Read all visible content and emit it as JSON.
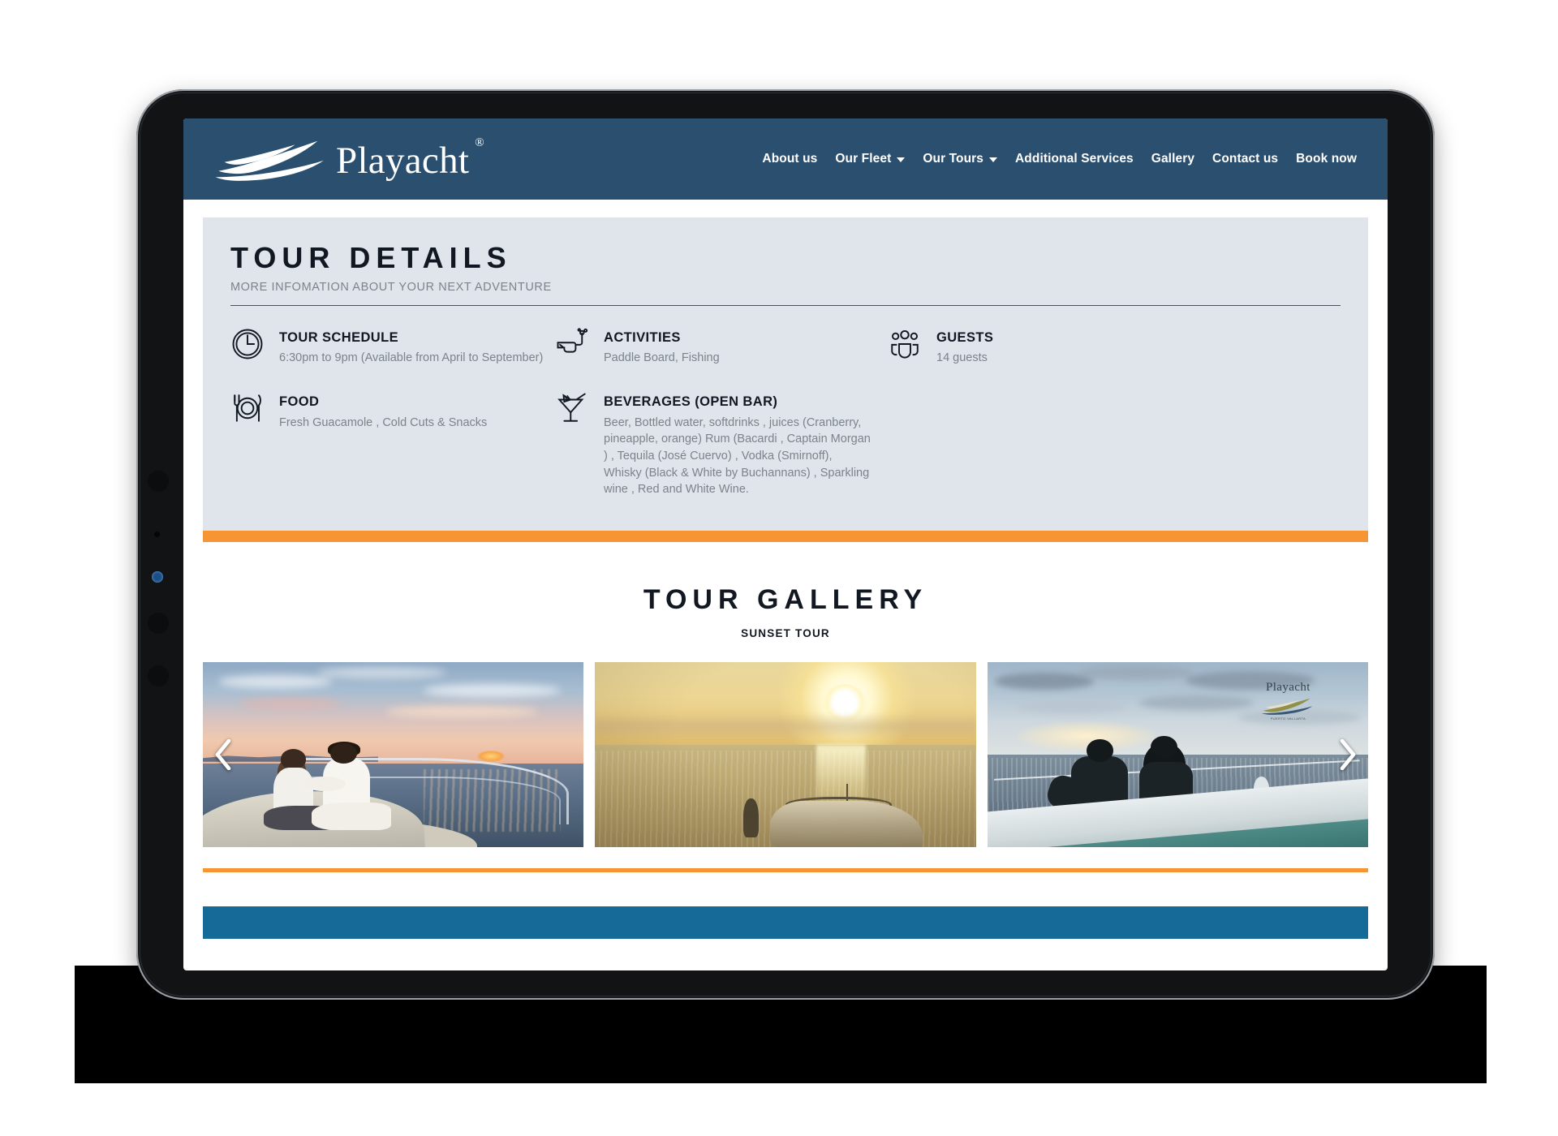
{
  "site": {
    "brand_name": "Playacht",
    "brand_trademark": "®"
  },
  "nav": {
    "items": [
      {
        "label": "About us",
        "has_caret": false
      },
      {
        "label": "Our Fleet",
        "has_caret": true
      },
      {
        "label": "Our Tours",
        "has_caret": true
      },
      {
        "label": "Additional Services",
        "has_caret": false
      },
      {
        "label": "Gallery",
        "has_caret": false
      },
      {
        "label": "Contact us",
        "has_caret": false
      },
      {
        "label": "Book now",
        "has_caret": false
      }
    ]
  },
  "tour_details": {
    "title": "TOUR DETAILS",
    "subtitle": "MORE INFOMATION ABOUT YOUR NEXT ADVENTURE",
    "items": [
      {
        "icon": "clock-icon",
        "label": "TOUR SCHEDULE",
        "value": "6:30pm to 9pm (Available from April to September)"
      },
      {
        "icon": "snorkel-mask-icon",
        "label": "ACTIVITIES",
        "value": "Paddle Board, Fishing"
      },
      {
        "icon": "guests-group-icon",
        "label": "GUESTS",
        "value": "14 guests"
      },
      {
        "icon": "plate-cutlery-icon",
        "label": "FOOD",
        "value": "Fresh Guacamole , Cold Cuts & Snacks"
      },
      {
        "icon": "cocktail-glass-icon",
        "label": "BEVERAGES (OPEN BAR)",
        "value": "Beer, Bottled water, softdrinks , juices (Cranberry, pineapple, orange) Rum (Bacardi , Captain Morgan ) , Tequila (José Cuervo) , Vodka (Smirnoff), Whisky (Black & White by Buchannans) , Sparkling wine , Red and White Wine."
      }
    ]
  },
  "gallery": {
    "title": "TOUR GALLERY",
    "subtitle": "SUNSET TOUR",
    "prev_arrow": "chevron-left-icon",
    "next_arrow": "chevron-right-icon",
    "slides": [
      {
        "alt": "Couple sitting on yacht bow at pastel sunset"
      },
      {
        "alt": "Golden sunset over ocean with boat silhouette"
      },
      {
        "alt": "Couple seated on boat bow watching cloudy dusk sky"
      }
    ],
    "watermark": {
      "brand": "Playacht",
      "tagline": "PUERTO VALLARTA"
    }
  },
  "colors": {
    "header_blue": "#2b4f6e",
    "panel_gray": "#dfe5ea",
    "accent_orange": "#f79434",
    "footer_blue": "#166a97",
    "heading_dark": "#111822",
    "muted_text": "#7c838b"
  }
}
